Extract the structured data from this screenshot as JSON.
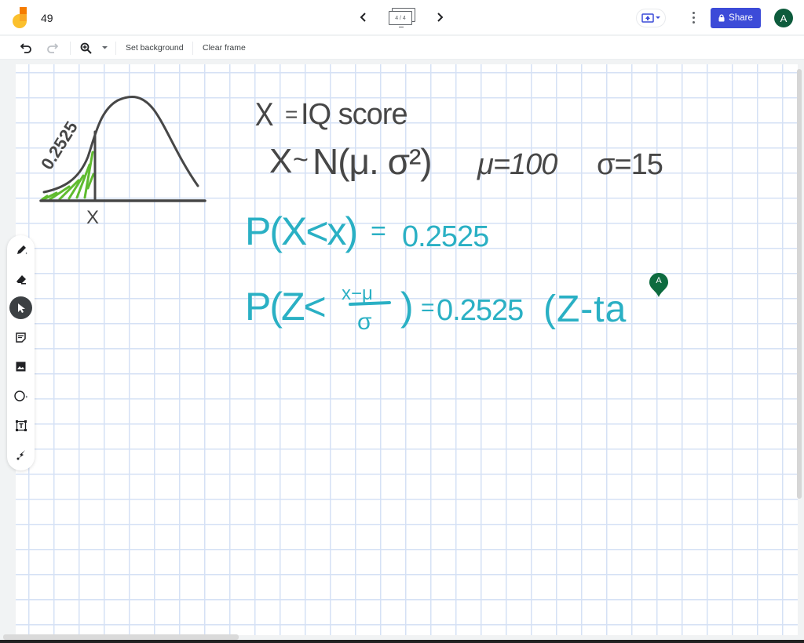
{
  "app": {
    "title": "49",
    "logo_colors": {
      "top": "#f57c00",
      "bottom": "#fbc02d"
    }
  },
  "header": {
    "prev_frame_label": "previous frame",
    "next_frame_label": "next frame",
    "frame_indicator": "4 / 4",
    "share_label": "Share",
    "avatar_initial": "A",
    "accent_color": "#3c4bd8",
    "avatar_color": "#0d5b3c"
  },
  "toolbar": {
    "undo": "undo",
    "redo": "redo",
    "zoom": "zoom",
    "set_background": "Set background",
    "clear_frame": "Clear frame"
  },
  "tools": [
    {
      "name": "pen",
      "active": false
    },
    {
      "name": "eraser",
      "active": false
    },
    {
      "name": "select",
      "active": true
    },
    {
      "name": "sticky-note",
      "active": false
    },
    {
      "name": "image",
      "active": false
    },
    {
      "name": "circle",
      "active": false
    },
    {
      "name": "text-box",
      "active": false
    },
    {
      "name": "laser",
      "active": false
    }
  ],
  "canvas": {
    "ink_dark": "#474747",
    "ink_teal": "#2ab0c4",
    "ink_green": "#5fbb2f",
    "sketch": {
      "area_label": "0.2525",
      "x_label": "X"
    },
    "lines": [
      "X = IQ score",
      "X ~ N(μ, σ²)   μ = 100   σ = 15",
      "P(X < x) = 0.2525",
      "P(Z < (x − μ)/σ) = 0.2525  (Z-ta"
    ],
    "line1": {
      "lhs": "X",
      "eq": "=",
      "rhs": "IQ score"
    },
    "line2": {
      "lhs": "X",
      "tilde": "~",
      "dist": "N(μ. σ²)",
      "mu": "μ=100",
      "sigma": "σ=15"
    },
    "line3": {
      "expr": "P(X<x)",
      "eq": "=",
      "val": "0.2525"
    },
    "line4": {
      "lhs": "P(Z<",
      "num": "x−μ",
      "den": "σ",
      "close": ")",
      "eq": "=",
      "val": "0.2525",
      "tail": "(Z-ta"
    },
    "collaborator_marker": "A"
  }
}
